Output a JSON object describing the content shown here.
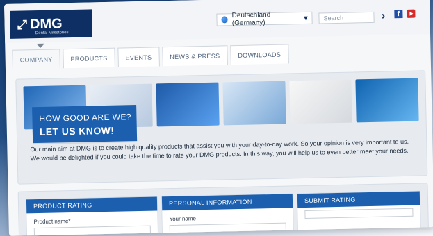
{
  "brand": {
    "name": "DMG",
    "mark": "⤢",
    "tagline": "Dental Milestones"
  },
  "topbar": {
    "country_label": "Deutschland (Germany)",
    "search_placeholder": "Search",
    "search_go": "›"
  },
  "nav": {
    "tabs": [
      {
        "label": "COMPANY"
      },
      {
        "label": "PRODUCTS"
      },
      {
        "label": "EVENTS"
      },
      {
        "label": "NEWS & PRESS"
      },
      {
        "label": "DOWNLOADS"
      }
    ]
  },
  "banner": {
    "heading_line1": "HOW GOOD ARE WE?",
    "heading_line2": "LET US KNOW!",
    "text": "Our main aim at DMG is to create high quality products that assist you with your day-to-day work. So your opinion is very important to us. We would be delighted if you could take the time to rate your DMG products. In this way, you will help us to even better meet your needs."
  },
  "form": {
    "col1": {
      "title": "PRODUCT RATING",
      "label": "Product name*"
    },
    "col2": {
      "title": "PERSONAL INFORMATION",
      "label": "Your name"
    },
    "col3": {
      "title": "SUBMIT RATING"
    }
  },
  "colors": {
    "brand_navy": "#0e2f63",
    "brand_blue": "#1b5fae"
  },
  "icons": {
    "flag": "flag-icon",
    "dropdown": "chevron-down-icon",
    "facebook": "facebook-icon",
    "youtube": "youtube-icon"
  }
}
